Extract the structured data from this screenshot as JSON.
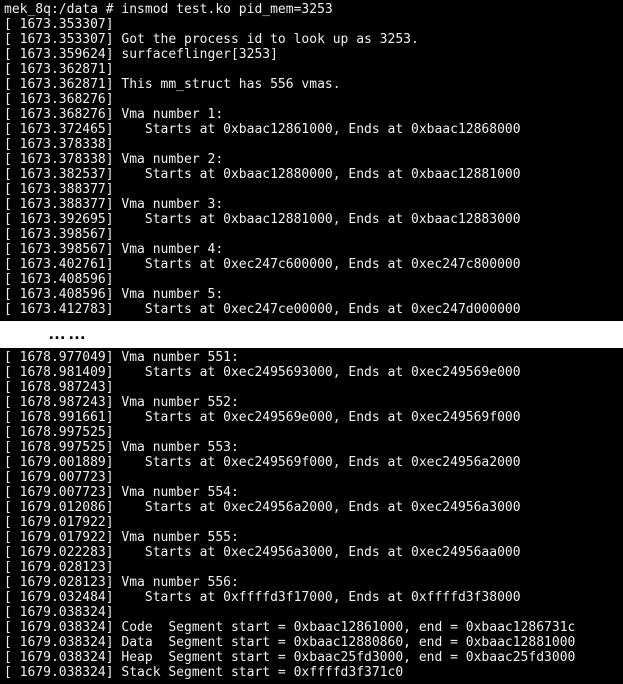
{
  "prompt": {
    "text": "mek_8q:/data #",
    "cmd": "insmod test.ko pid_mem=3253"
  },
  "ellipsis": "……",
  "lines_top": [
    {
      "ts": "1673.353307",
      "msg": ""
    },
    {
      "ts": "1673.353307",
      "msg": "Got the process id to look up as 3253."
    },
    {
      "ts": "1673.359624",
      "msg": "surfaceflinger[3253]"
    },
    {
      "ts": "1673.362871",
      "msg": ""
    },
    {
      "ts": "1673.362871",
      "msg": "This mm_struct has 556 vmas."
    },
    {
      "ts": "1673.368276",
      "msg": ""
    },
    {
      "ts": "1673.368276",
      "msg": "Vma number 1:"
    },
    {
      "ts": "1673.372465",
      "msg": "   Starts at 0xbaac12861000, Ends at 0xbaac12868000"
    },
    {
      "ts": "1673.378338",
      "msg": ""
    },
    {
      "ts": "1673.378338",
      "msg": "Vma number 2:"
    },
    {
      "ts": "1673.382537",
      "msg": "   Starts at 0xbaac12880000, Ends at 0xbaac12881000"
    },
    {
      "ts": "1673.388377",
      "msg": ""
    },
    {
      "ts": "1673.388377",
      "msg": "Vma number 3:"
    },
    {
      "ts": "1673.392695",
      "msg": "   Starts at 0xbaac12881000, Ends at 0xbaac12883000"
    },
    {
      "ts": "1673.398567",
      "msg": ""
    },
    {
      "ts": "1673.398567",
      "msg": "Vma number 4:"
    },
    {
      "ts": "1673.402761",
      "msg": "   Starts at 0xec247c600000, Ends at 0xec247c800000"
    },
    {
      "ts": "1673.408596",
      "msg": ""
    },
    {
      "ts": "1673.408596",
      "msg": "Vma number 5:"
    },
    {
      "ts": "1673.412783",
      "msg": "   Starts at 0xec247ce00000, Ends at 0xec247d000000"
    }
  ],
  "lines_bottom": [
    {
      "ts": "1678.977049",
      "msg": "Vma number 551:"
    },
    {
      "ts": "1678.981409",
      "msg": "   Starts at 0xec2495693000, Ends at 0xec249569e000"
    },
    {
      "ts": "1678.987243",
      "msg": ""
    },
    {
      "ts": "1678.987243",
      "msg": "Vma number 552:"
    },
    {
      "ts": "1678.991661",
      "msg": "   Starts at 0xec249569e000, Ends at 0xec249569f000"
    },
    {
      "ts": "1678.997525",
      "msg": ""
    },
    {
      "ts": "1678.997525",
      "msg": "Vma number 553:"
    },
    {
      "ts": "1679.001889",
      "msg": "   Starts at 0xec249569f000, Ends at 0xec24956a2000"
    },
    {
      "ts": "1679.007723",
      "msg": ""
    },
    {
      "ts": "1679.007723",
      "msg": "Vma number 554:"
    },
    {
      "ts": "1679.012086",
      "msg": "   Starts at 0xec24956a2000, Ends at 0xec24956a3000"
    },
    {
      "ts": "1679.017922",
      "msg": ""
    },
    {
      "ts": "1679.017922",
      "msg": "Vma number 555:"
    },
    {
      "ts": "1679.022283",
      "msg": "   Starts at 0xec24956a3000, Ends at 0xec24956aa000"
    },
    {
      "ts": "1679.028123",
      "msg": ""
    },
    {
      "ts": "1679.028123",
      "msg": "Vma number 556:"
    },
    {
      "ts": "1679.032484",
      "msg": "   Starts at 0xffffd3f17000, Ends at 0xffffd3f38000"
    },
    {
      "ts": "1679.038324",
      "msg": ""
    },
    {
      "ts": "1679.038324",
      "msg": "Code  Segment start = 0xbaac12861000, end = 0xbaac1286731c"
    },
    {
      "ts": "1679.038324",
      "msg": "Data  Segment start = 0xbaac12880860, end = 0xbaac12881000"
    },
    {
      "ts": "1679.038324",
      "msg": "Heap  Segment start = 0xbaac25fd3000, end = 0xbaac25fd3000"
    },
    {
      "ts": "1679.038324",
      "msg": "Stack Segment start = 0xffffd3f371c0"
    }
  ],
  "chart_data": {
    "type": "table",
    "title": "Kernel dmesg output: VMA listing and segment addresses for PID 3253 (surfaceflinger)",
    "process": {
      "pid": 3253,
      "name": "surfaceflinger",
      "vma_count": 556
    },
    "vmas": [
      {
        "n": 1,
        "start": "0xbaac12861000",
        "end": "0xbaac12868000"
      },
      {
        "n": 2,
        "start": "0xbaac12880000",
        "end": "0xbaac12881000"
      },
      {
        "n": 3,
        "start": "0xbaac12881000",
        "end": "0xbaac12883000"
      },
      {
        "n": 4,
        "start": "0xec247c600000",
        "end": "0xec247c800000"
      },
      {
        "n": 5,
        "start": "0xec247ce00000",
        "end": "0xec247d000000"
      },
      {
        "n": 551,
        "start": "0xec2495693000",
        "end": "0xec249569e000"
      },
      {
        "n": 552,
        "start": "0xec249569e000",
        "end": "0xec249569f000"
      },
      {
        "n": 553,
        "start": "0xec249569f000",
        "end": "0xec24956a2000"
      },
      {
        "n": 554,
        "start": "0xec24956a2000",
        "end": "0xec24956a3000"
      },
      {
        "n": 555,
        "start": "0xec24956a3000",
        "end": "0xec24956aa000"
      },
      {
        "n": 556,
        "start": "0xffffd3f17000",
        "end": "0xffffd3f38000"
      }
    ],
    "segments": {
      "code": {
        "start": "0xbaac12861000",
        "end": "0xbaac1286731c"
      },
      "data": {
        "start": "0xbaac12880860",
        "end": "0xbaac12881000"
      },
      "heap": {
        "start": "0xbaac25fd3000",
        "end": "0xbaac25fd3000"
      },
      "stack": {
        "start": "0xffffd3f371c0"
      }
    }
  }
}
